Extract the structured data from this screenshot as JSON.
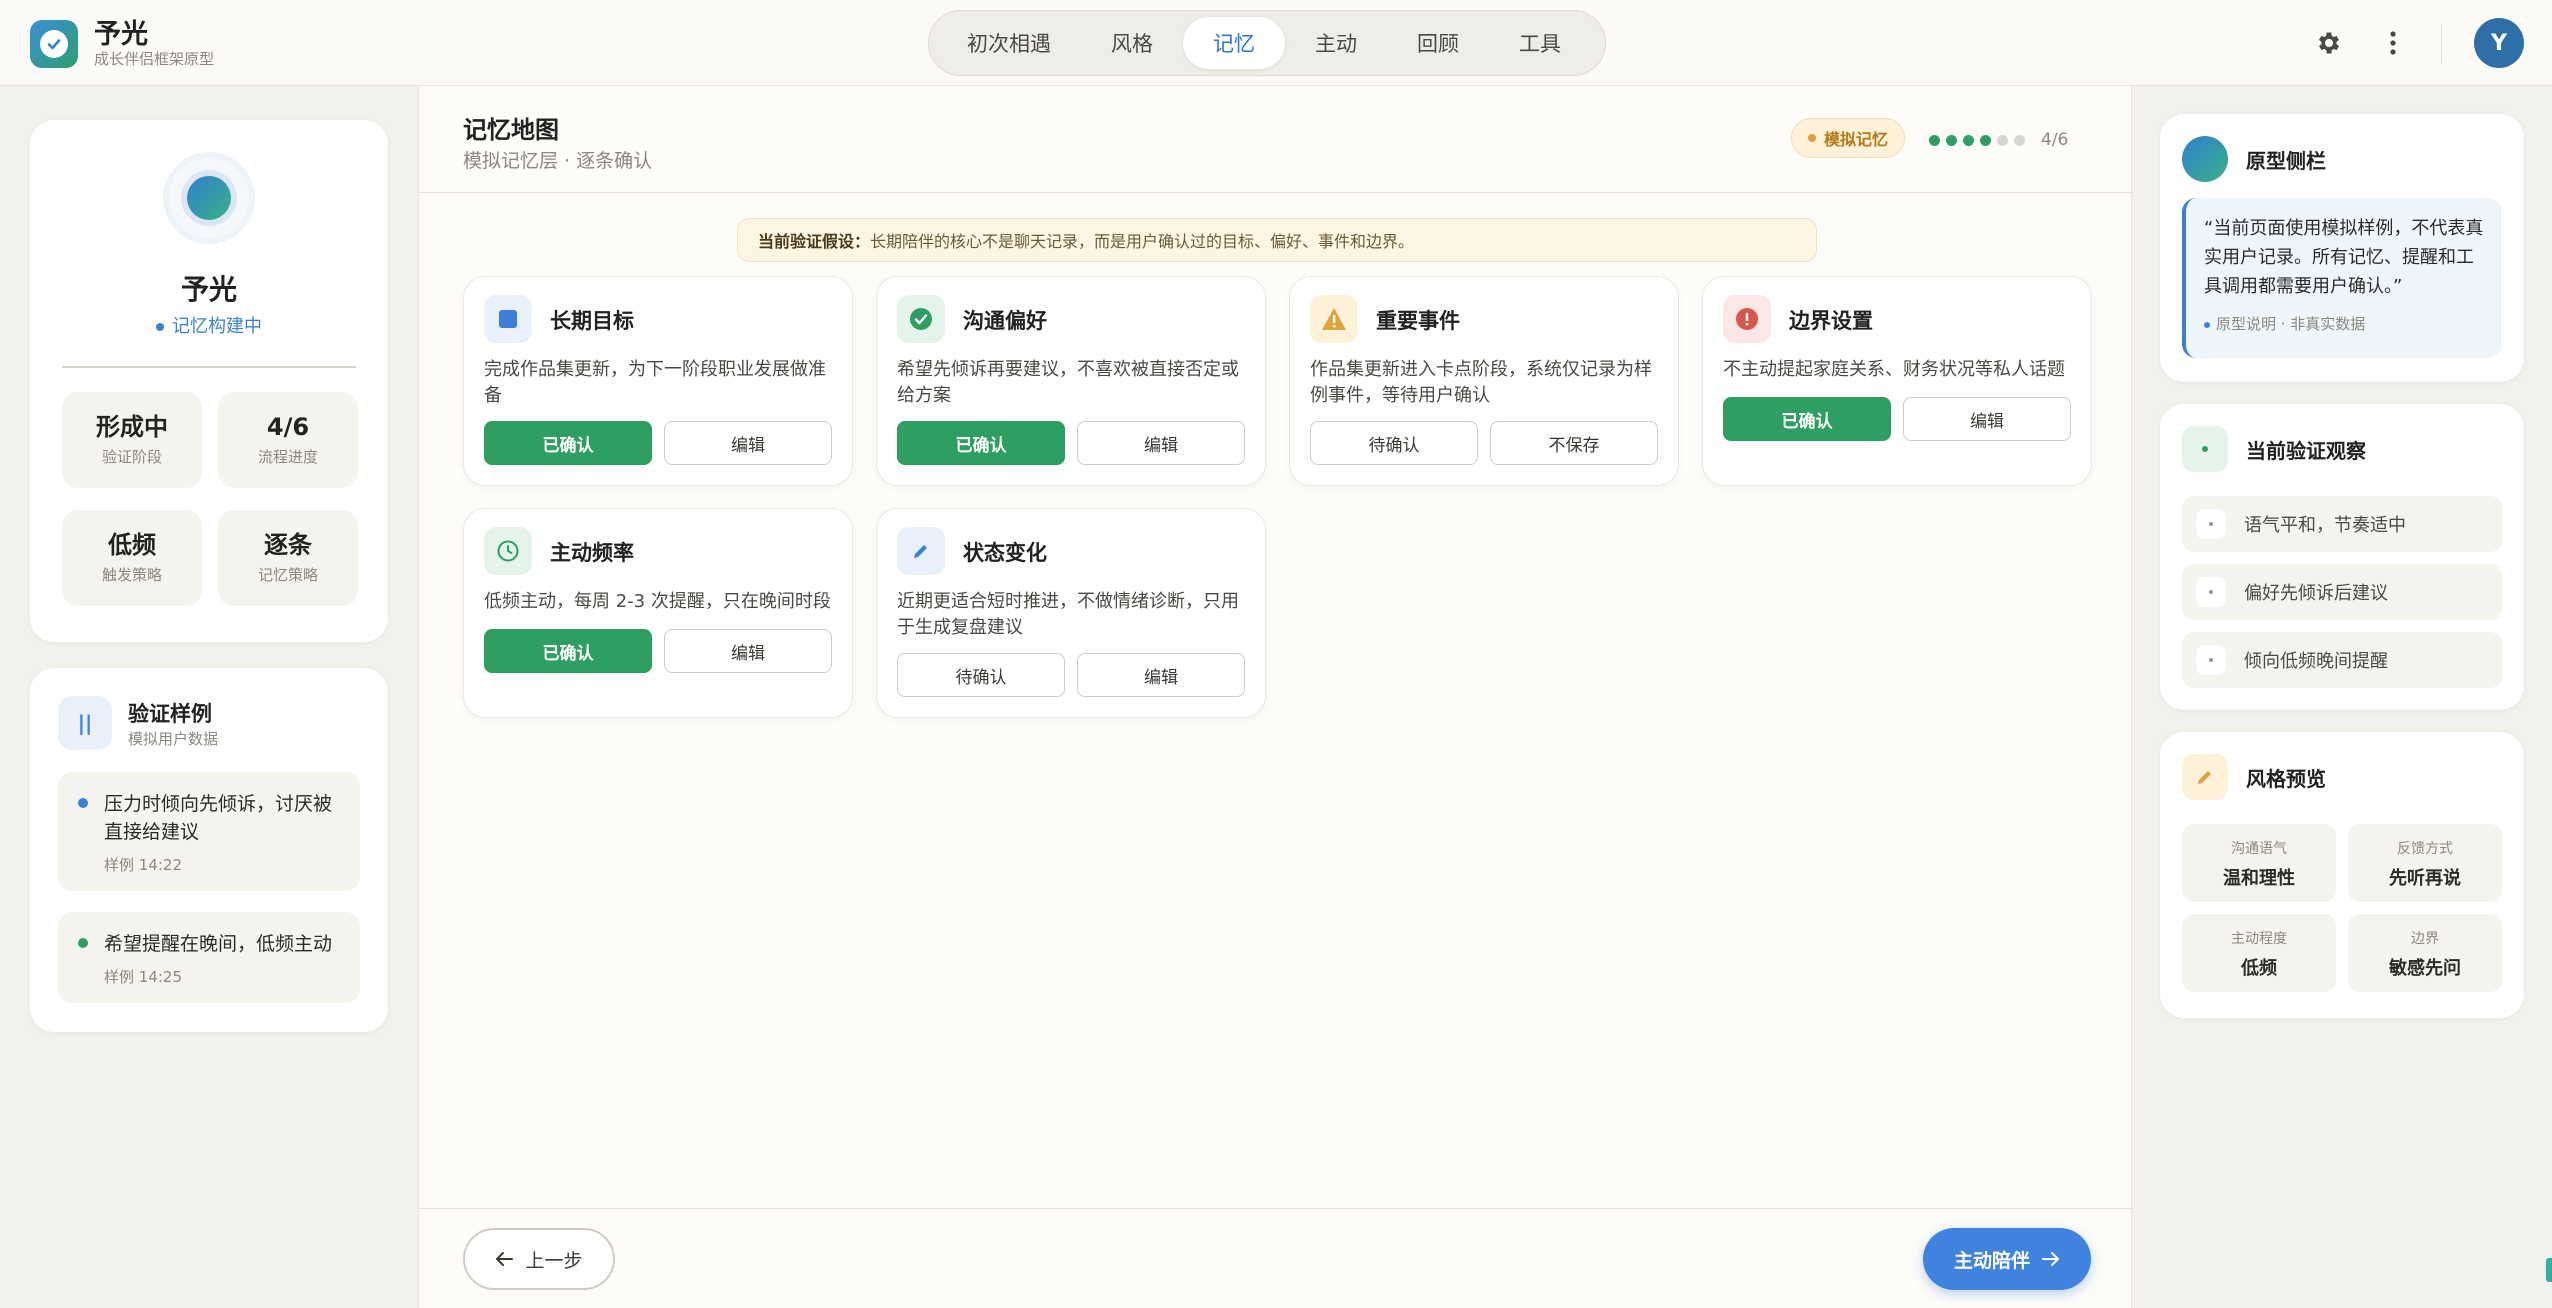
{
  "brand": {
    "name": "予光",
    "subtitle": "成长伴侣框架原型",
    "logo_icon": "check-badge-icon"
  },
  "nav": {
    "tabs": [
      {
        "label": "初次相遇",
        "active": false
      },
      {
        "label": "风格",
        "active": false
      },
      {
        "label": "记忆",
        "active": true
      },
      {
        "label": "主动",
        "active": false
      },
      {
        "label": "回顾",
        "active": false
      },
      {
        "label": "工具",
        "active": false
      }
    ]
  },
  "top_actions": {
    "settings_icon": "gear-icon",
    "more_icon": "more-vertical-icon",
    "avatar_initial": "Y"
  },
  "profile": {
    "name": "予光",
    "status": "记忆构建中",
    "stats": [
      {
        "value": "形成中",
        "label": "验证阶段"
      },
      {
        "value": "4/6",
        "label": "流程进度"
      },
      {
        "value": "低频",
        "label": "触发策略"
      },
      {
        "value": "逐条",
        "label": "记忆策略"
      }
    ]
  },
  "samples": {
    "title": "验证样例",
    "subtitle": "模拟用户数据",
    "items": [
      {
        "text": "压力时倾向先倾诉，讨厌被直接给建议",
        "time": "样例 14:22",
        "color": "#3d7fd7"
      },
      {
        "text": "希望提醒在晚间，低频主动",
        "time": "样例 14:25",
        "color": "#2f9e62"
      }
    ]
  },
  "main": {
    "title": "记忆地图",
    "subtitle": "模拟记忆层 · 逐条确认",
    "badge": "模拟记忆",
    "progress": {
      "done": 4,
      "total": 6,
      "text": "4/6"
    },
    "hypothesis_label": "当前验证假设：",
    "hypothesis_text": "长期陪伴的核心不是聊天记录，而是用户确认过的目标、偏好、事件和边界。",
    "cards": [
      {
        "title": "长期目标",
        "desc": "完成作品集更新，为下一阶段职业发展做准备",
        "primary": "已确认",
        "secondary": "编辑",
        "confirmed": true,
        "icon": "square-icon"
      },
      {
        "title": "沟通偏好",
        "desc": "希望先倾诉再要建议，不喜欢被直接否定或给方案",
        "primary": "已确认",
        "secondary": "编辑",
        "confirmed": true,
        "icon": "check-circle-icon"
      },
      {
        "title": "重要事件",
        "desc": "作品集更新进入卡点阶段，系统仅记录为样例事件，等待用户确认",
        "primary": "待确认",
        "secondary": "不保存",
        "confirmed": false,
        "icon": "warning-icon"
      },
      {
        "title": "边界设置",
        "desc": "不主动提起家庭关系、财务状况等私人话题",
        "primary": "已确认",
        "secondary": "编辑",
        "confirmed": true,
        "icon": "alert-circle-icon"
      },
      {
        "title": "主动频率",
        "desc": "低频主动，每周 2-3 次提醒，只在晚间时段",
        "primary": "已确认",
        "secondary": "编辑",
        "confirmed": true,
        "icon": "clock-icon"
      },
      {
        "title": "状态变化",
        "desc": "近期更适合短时推进，不做情绪诊断，只用于生成复盘建议",
        "primary": "待确认",
        "secondary": "编辑",
        "confirmed": false,
        "icon": "pencil-icon"
      }
    ],
    "back_label": "上一步",
    "next_label": "主动陪伴"
  },
  "sidebar": {
    "title": "原型侧栏",
    "quote": "“当前页面使用模拟样例，不代表真实用户记录。所有记忆、提醒和工具调用都需要用户确认。”",
    "note": "原型说明 · 非真实数据"
  },
  "observations": {
    "title": "当前验证观察",
    "items": [
      "语气平和，节奏适中",
      "偏好先倾诉后建议",
      "倾向低频晚间提醒"
    ]
  },
  "style_preview": {
    "title": "风格预览",
    "cells": [
      {
        "key": "沟通语气",
        "value": "温和理性"
      },
      {
        "key": "反馈方式",
        "value": "先听再说"
      },
      {
        "key": "主动程度",
        "value": "低频"
      },
      {
        "key": "边界",
        "value": "敏感先问"
      }
    ]
  },
  "colors": {
    "accent_blue": "#3d7fd7",
    "confirm_green": "#2f9e62",
    "badge_amber": "#b37a15"
  }
}
